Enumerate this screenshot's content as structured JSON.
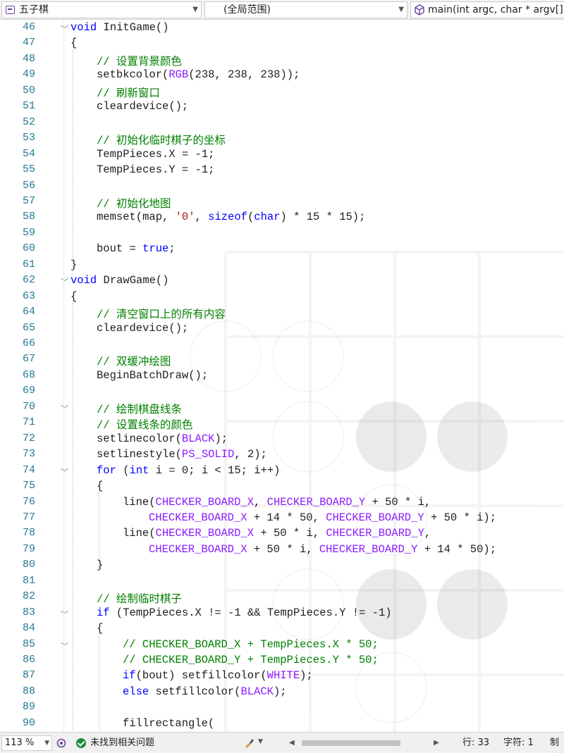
{
  "navbar": {
    "project": "五子棋",
    "scope": "(全局范围)",
    "member": "main(int argc, char * argv[]"
  },
  "editor": {
    "lines": [
      {
        "n": "46",
        "indent": 0,
        "fold": "v",
        "tokens": [
          [
            "kw",
            "void"
          ],
          [
            "t",
            " InitGame()"
          ]
        ]
      },
      {
        "n": "47",
        "indent": 0,
        "tokens": [
          [
            "t",
            "{"
          ]
        ]
      },
      {
        "n": "48",
        "indent": 1,
        "tokens": [
          [
            "cm",
            "// 设置背景颜色"
          ]
        ]
      },
      {
        "n": "49",
        "indent": 1,
        "tokens": [
          [
            "t",
            "setbkcolor("
          ],
          [
            "mac",
            "RGB"
          ],
          [
            "t",
            "(238, 238, 238));"
          ]
        ]
      },
      {
        "n": "50",
        "indent": 1,
        "tokens": [
          [
            "cm",
            "// 刷新窗口"
          ]
        ]
      },
      {
        "n": "51",
        "indent": 1,
        "tokens": [
          [
            "t",
            "cleardevice();"
          ]
        ]
      },
      {
        "n": "52",
        "indent": 1,
        "tokens": []
      },
      {
        "n": "53",
        "indent": 1,
        "tokens": [
          [
            "cm",
            "// 初始化临时棋子的坐标"
          ]
        ]
      },
      {
        "n": "54",
        "indent": 1,
        "tokens": [
          [
            "t",
            "TempPieces.X = -1;"
          ]
        ]
      },
      {
        "n": "55",
        "indent": 1,
        "tokens": [
          [
            "t",
            "TempPieces.Y = -1;"
          ]
        ]
      },
      {
        "n": "56",
        "indent": 1,
        "tokens": []
      },
      {
        "n": "57",
        "indent": 1,
        "tokens": [
          [
            "cm",
            "// 初始化地图"
          ]
        ]
      },
      {
        "n": "58",
        "indent": 1,
        "tokens": [
          [
            "t",
            "memset(map, "
          ],
          [
            "str",
            "'0'"
          ],
          [
            "t",
            ", "
          ],
          [
            "kw",
            "sizeof"
          ],
          [
            "t",
            "("
          ],
          [
            "kw",
            "char"
          ],
          [
            "t",
            ") * 15 * 15);"
          ]
        ]
      },
      {
        "n": "59",
        "indent": 1,
        "tokens": []
      },
      {
        "n": "60",
        "indent": 1,
        "tokens": [
          [
            "t",
            "bout = "
          ],
          [
            "kw",
            "true"
          ],
          [
            "t",
            ";"
          ]
        ]
      },
      {
        "n": "61",
        "indent": 0,
        "tokens": [
          [
            "t",
            "}"
          ]
        ]
      },
      {
        "n": "62",
        "indent": 0,
        "fold": "v",
        "tokens": [
          [
            "kw",
            "void"
          ],
          [
            "t",
            " DrawGame()"
          ]
        ]
      },
      {
        "n": "63",
        "indent": 0,
        "tokens": [
          [
            "t",
            "{"
          ]
        ]
      },
      {
        "n": "64",
        "indent": 1,
        "tokens": [
          [
            "cm",
            "// 清空窗口上的所有内容"
          ]
        ]
      },
      {
        "n": "65",
        "indent": 1,
        "tokens": [
          [
            "t",
            "cleardevice();"
          ]
        ]
      },
      {
        "n": "66",
        "indent": 1,
        "tokens": []
      },
      {
        "n": "67",
        "indent": 1,
        "tokens": [
          [
            "cm",
            "// 双缓冲绘图"
          ]
        ]
      },
      {
        "n": "68",
        "indent": 1,
        "tokens": [
          [
            "t",
            "BeginBatchDraw();"
          ]
        ]
      },
      {
        "n": "69",
        "indent": 1,
        "tokens": []
      },
      {
        "n": "70",
        "indent": 1,
        "fold": "v",
        "tokens": [
          [
            "cm",
            "// 绘制棋盘线条"
          ]
        ]
      },
      {
        "n": "71",
        "indent": 1,
        "tokens": [
          [
            "cm",
            "// 设置线条的颜色"
          ]
        ]
      },
      {
        "n": "72",
        "indent": 1,
        "tokens": [
          [
            "t",
            "setlinecolor("
          ],
          [
            "mac",
            "BLACK"
          ],
          [
            "t",
            ");"
          ]
        ]
      },
      {
        "n": "73",
        "indent": 1,
        "tokens": [
          [
            "t",
            "setlinestyle("
          ],
          [
            "mac",
            "PS_SOLID"
          ],
          [
            "t",
            ", 2);"
          ]
        ]
      },
      {
        "n": "74",
        "indent": 1,
        "fold": "v",
        "tokens": [
          [
            "kw",
            "for"
          ],
          [
            "t",
            " ("
          ],
          [
            "kw",
            "int"
          ],
          [
            "t",
            " i = 0; i < 15; i++)"
          ]
        ]
      },
      {
        "n": "75",
        "indent": 1,
        "tokens": [
          [
            "t",
            "{"
          ]
        ]
      },
      {
        "n": "76",
        "indent": 2,
        "tokens": [
          [
            "t",
            "line("
          ],
          [
            "mac",
            "CHECKER_BOARD_X"
          ],
          [
            "t",
            ", "
          ],
          [
            "mac",
            "CHECKER_BOARD_Y"
          ],
          [
            "t",
            " + 50 * i,"
          ]
        ]
      },
      {
        "n": "77",
        "indent": 3,
        "tokens": [
          [
            "mac",
            "CHECKER_BOARD_X"
          ],
          [
            "t",
            " + 14 * 50, "
          ],
          [
            "mac",
            "CHECKER_BOARD_Y"
          ],
          [
            "t",
            " + 50 * i);"
          ]
        ]
      },
      {
        "n": "78",
        "indent": 2,
        "tokens": [
          [
            "t",
            "line("
          ],
          [
            "mac",
            "CHECKER_BOARD_X"
          ],
          [
            "t",
            " + 50 * i, "
          ],
          [
            "mac",
            "CHECKER_BOARD_Y"
          ],
          [
            "t",
            ","
          ]
        ]
      },
      {
        "n": "79",
        "indent": 3,
        "tokens": [
          [
            "mac",
            "CHECKER_BOARD_X"
          ],
          [
            "t",
            " + 50 * i, "
          ],
          [
            "mac",
            "CHECKER_BOARD_Y"
          ],
          [
            "t",
            " + 14 * 50);"
          ]
        ]
      },
      {
        "n": "80",
        "indent": 1,
        "tokens": [
          [
            "t",
            "}"
          ]
        ]
      },
      {
        "n": "81",
        "indent": 1,
        "tokens": []
      },
      {
        "n": "82",
        "indent": 1,
        "tokens": [
          [
            "cm",
            "// 绘制临时棋子"
          ]
        ]
      },
      {
        "n": "83",
        "indent": 1,
        "fold": "v",
        "tokens": [
          [
            "kw",
            "if"
          ],
          [
            "t",
            " (TempPieces.X != -1 && TempPieces.Y != -1)"
          ]
        ]
      },
      {
        "n": "84",
        "indent": 1,
        "tokens": [
          [
            "t",
            "{"
          ]
        ]
      },
      {
        "n": "85",
        "indent": 2,
        "fold": "v",
        "tokens": [
          [
            "cm",
            "// CHECKER_BOARD_X + TempPieces.X * 50;"
          ]
        ]
      },
      {
        "n": "86",
        "indent": 2,
        "tokens": [
          [
            "cm",
            "// CHECKER_BOARD_Y + TempPieces.Y * 50;"
          ]
        ]
      },
      {
        "n": "87",
        "indent": 2,
        "tokens": [
          [
            "kw",
            "if"
          ],
          [
            "t",
            "(bout) setfillcolor("
          ],
          [
            "mac",
            "WHITE"
          ],
          [
            "t",
            ");"
          ]
        ]
      },
      {
        "n": "88",
        "indent": 2,
        "tokens": [
          [
            "kw",
            "else"
          ],
          [
            "t",
            " setfillcolor("
          ],
          [
            "mac",
            "BLACK"
          ],
          [
            "t",
            ");"
          ]
        ]
      },
      {
        "n": "89",
        "indent": 2,
        "tokens": []
      },
      {
        "n": "90",
        "indent": 2,
        "tokens": [
          [
            "t",
            "fillrectangle("
          ]
        ]
      }
    ]
  },
  "statusbar": {
    "zoom": "113 %",
    "issues": "未找到相关问题",
    "line": "行: 33",
    "char": "字符: 1",
    "tab": "制表"
  },
  "colors": {
    "keyword": "#0000ff",
    "comment": "#008000",
    "macro": "#8a1bff",
    "string": "#a31515",
    "line_number": "#237893"
  },
  "icons": [
    "project-icon",
    "cube-icon",
    "check-circle-icon",
    "brush-icon",
    "git-icon"
  ]
}
